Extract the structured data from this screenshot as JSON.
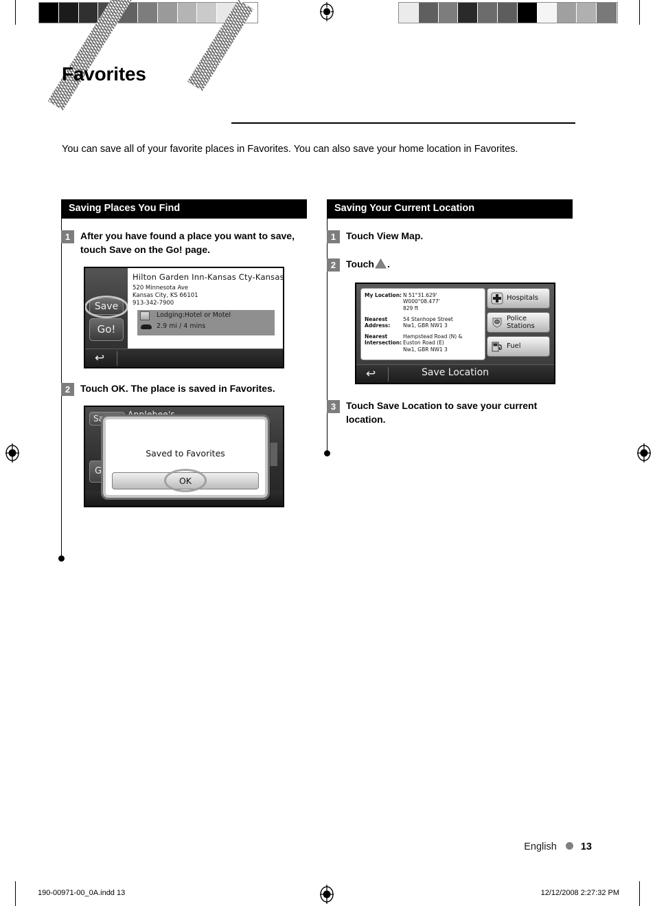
{
  "print_marks": {
    "calibration_left": [
      "#000000",
      "#1b1b1b",
      "#303030",
      "#4a4a4a",
      "#626262",
      "#7d7d7d",
      "#9a9a9a",
      "#b4b4b4",
      "#cacaca",
      "#e8e8e8",
      "#ffffff"
    ],
    "calibration_right": [
      "#ebebeb",
      "#5f5f5f",
      "#7d7d7d",
      "#2a2a2a",
      "#6c6c6c",
      "#5d5d5d",
      "#000000",
      "#f5f5f5",
      "#a0a0a0",
      "#b0b0b0",
      "#797979"
    ],
    "registration_icon": "registration-target-icon",
    "file_name": "190-00971-00_0A.indd   13",
    "print_timestamp": "12/12/2008   2:27:32 PM"
  },
  "header": {
    "title": "Favorites",
    "intro": "You can save all of your favorite places in Favorites. You can also save your home location in Favorites."
  },
  "left_column": {
    "section_title": "Saving Places You Find",
    "steps": [
      {
        "num": "1",
        "text": "After you have found a place you want to save, touch Save on the Go! page."
      },
      {
        "num": "2",
        "text": "Touch OK. The place is saved in Favorites."
      }
    ],
    "screenshot_go": {
      "place_name": "Hilton Garden Inn-Kansas Cty-Kansas",
      "address_line1": "520 Minnesota Ave",
      "address_line2": "Kansas City, KS 66101",
      "phone": "913-342-7900",
      "category": "Lodging:Hotel or Motel",
      "distance": "2.9 mi /  4 mins",
      "save_label": "Save",
      "go_label": "Go!",
      "back_glyph": "↩"
    },
    "screenshot_saved": {
      "background_button": "Sa",
      "background_title": "Applebee's",
      "background_button2": "G",
      "dialog_message": "Saved to Favorites",
      "ok_label": "OK"
    }
  },
  "right_column": {
    "section_title": "Saving Your Current Location",
    "steps": [
      {
        "num": "1",
        "text": "Touch View Map."
      },
      {
        "num": "2",
        "text": "Touch",
        "text_after": ".",
        "icon": "triangle-up-icon"
      },
      {
        "num": "3",
        "text": "Touch Save Location to save your current location."
      }
    ],
    "screenshot_location": {
      "rows": [
        {
          "label": "My Location:",
          "value": "N 51°31.629'\nW000°08.477'\n829 ft"
        },
        {
          "label": "Nearest Address:",
          "value": "54 Stanhope Street\nNw1, GBR NW1 3"
        },
        {
          "label": "Nearest Intersection:",
          "value": "Hampstead Road (N) &\nEuston Road (E)\nNw1, GBR NW1 3"
        }
      ],
      "buttons": [
        {
          "label": "Hospitals",
          "icon": "medical-cross-icon"
        },
        {
          "label": "Police\nStations",
          "icon": "police-badge-icon"
        },
        {
          "label": "Fuel",
          "icon": "fuel-pump-icon"
        }
      ],
      "save_location_label": "Save Location",
      "back_glyph": "↩"
    }
  },
  "footer": {
    "language": "English",
    "page_number": "13"
  }
}
